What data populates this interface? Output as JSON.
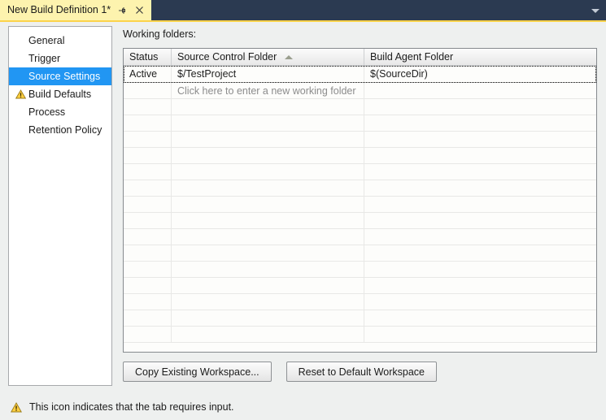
{
  "window": {
    "tab_title": "New Build Definition 1*",
    "pin_icon": "pin-icon",
    "close_icon": "close-icon",
    "dropdown_icon": "chevron-down-icon",
    "tab_bar_color": "#2b3a51",
    "tab_color": "#fdf3ae",
    "accent_underline_color": "#fcd34a"
  },
  "sidebar": {
    "selected_color": "#2196f3",
    "items": [
      {
        "label": "General",
        "selected": false,
        "warning": false
      },
      {
        "label": "Trigger",
        "selected": false,
        "warning": false
      },
      {
        "label": "Source Settings",
        "selected": true,
        "warning": false
      },
      {
        "label": "Build Defaults",
        "selected": false,
        "warning": true
      },
      {
        "label": "Process",
        "selected": false,
        "warning": false
      },
      {
        "label": "Retention Policy",
        "selected": false,
        "warning": false
      }
    ]
  },
  "main": {
    "section_label": "Working folders:",
    "grid": {
      "columns": [
        {
          "label": "Status",
          "sorted": false
        },
        {
          "label": "Source Control Folder",
          "sorted": true,
          "sort_direction": "ascending"
        },
        {
          "label": "Build Agent Folder",
          "sorted": false
        }
      ],
      "rows": [
        {
          "status": "Active",
          "source_control_folder": "$/TestProject",
          "build_agent_folder": "$(SourceDir)",
          "focused": true,
          "is_new_row_placeholder": false
        },
        {
          "status": "",
          "source_control_folder": "Click here to enter a new working folder",
          "build_agent_folder": "",
          "focused": false,
          "is_new_row_placeholder": true
        }
      ],
      "empty_row_count": 15
    },
    "buttons": [
      {
        "label": "Copy Existing Workspace..."
      },
      {
        "label": "Reset to Default Workspace"
      }
    ]
  },
  "statusbar": {
    "warning_icon": "warning-triangle-icon",
    "message": "This icon indicates that the tab requires input."
  }
}
